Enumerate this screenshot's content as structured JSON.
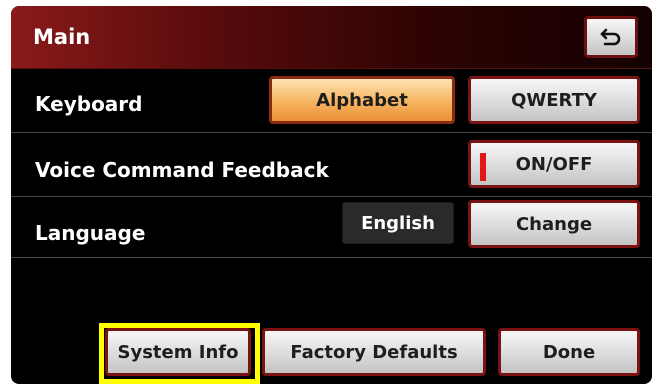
{
  "header": {
    "title": "Main",
    "back_icon": "return-arrow-icon"
  },
  "keyboard": {
    "label": "Keyboard",
    "options": [
      "Alphabet",
      "QWERTY"
    ],
    "selected": "Alphabet"
  },
  "voice_feedback": {
    "label": "Voice Command Feedback",
    "toggle_label": "ON/OFF",
    "state": "on",
    "indicator_color": "#e01818"
  },
  "language": {
    "label": "Language",
    "value": "English",
    "change_label": "Change"
  },
  "footer": {
    "system_info": "System Info",
    "factory_defaults": "Factory Defaults",
    "done": "Done"
  },
  "highlight_color": "#ffff00"
}
